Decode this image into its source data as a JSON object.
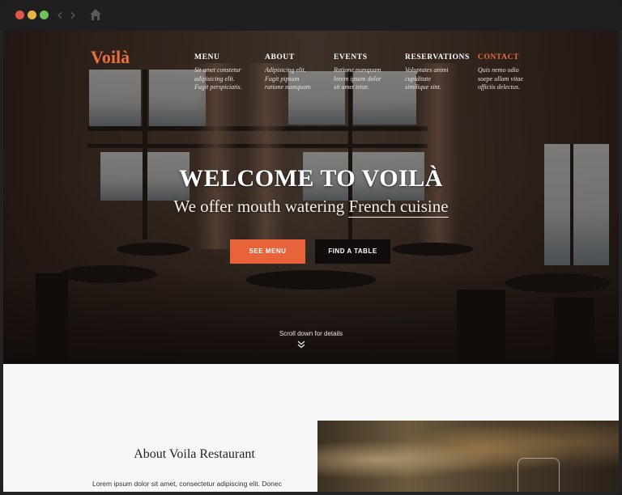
{
  "browser": {
    "back_icon": "chevron-left-icon",
    "forward_icon": "chevron-right-icon",
    "home_icon": "home-icon"
  },
  "colors": {
    "accent": "#e8703e",
    "primary_button": "#e8633a",
    "secondary_button": "#0f0c0b"
  },
  "header": {
    "logo": "Voilà",
    "nav": [
      {
        "title": "MENU",
        "desc": "Sit amet constetur\nadipisicing elit.\nFugit perspiciatis.",
        "active": false
      },
      {
        "title": "ABOUT",
        "desc": "Adipisicing elit.\nFugit pipsam\nratione numquam",
        "active": false
      },
      {
        "title": "EVENTS",
        "desc": "Ratione numquam\nlorem ipsum dolor\nsit amet tetur.",
        "active": false
      },
      {
        "title": "RESERVATIONS",
        "desc": "Voluptates animi\ncupiditate\nsimilique sint.",
        "active": false
      },
      {
        "title": "CONTACT",
        "desc": "Quis nemo odio\nsoepe ullam vitae\nofficiis delectus.",
        "active": true
      }
    ]
  },
  "hero": {
    "title": "WELCOME TO VOILÀ",
    "subtitle_pre": "We offer mouth watering ",
    "subtitle_underlined": "French cuisine",
    "primary_button": "SEE MENU",
    "secondary_button": "FIND A TABLE",
    "scroll_text": "Scroll down for details",
    "scroll_icon": "double-chevron-down-icon"
  },
  "about": {
    "title": "About Voila Restaurant",
    "body": "Lorem ipsum dolor sit amet, consectetur adipiscing elit. Donec"
  }
}
